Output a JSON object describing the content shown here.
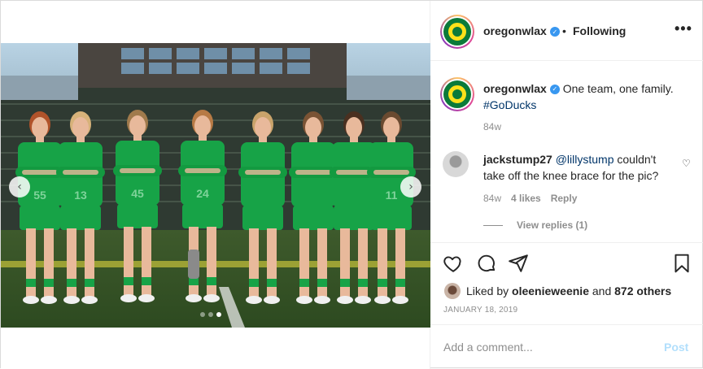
{
  "header": {
    "username": "oregonwlax",
    "separator": "•",
    "follow_status": "Following",
    "more_label": "•••",
    "verified_icon": "✓"
  },
  "caption": {
    "username": "oregonwlax",
    "text": "One team, one family.",
    "hashtag": "#GoDucks",
    "time": "84w"
  },
  "comment": {
    "username": "jackstump27",
    "mention": "@lillystump",
    "text": "couldn't take off the knee brace for the pic?",
    "time": "84w",
    "likes": "4 likes",
    "reply_label": "Reply",
    "view_replies": "View replies (1)",
    "like_icon": "heart-outline"
  },
  "likes": {
    "prefix": "Liked by",
    "user": "oleenieweenie",
    "middle": "and",
    "others": "872 others"
  },
  "date": "JANUARY 18, 2019",
  "add_comment": {
    "placeholder": "Add a comment...",
    "post_label": "Post"
  },
  "carousel": {
    "prev_icon": "‹",
    "next_icon": "›",
    "slide_count": 3,
    "active_index": 2
  },
  "photo": {
    "jersey_numbers": [
      "55",
      "13",
      "45",
      "24",
      "",
      "",
      "",
      "11"
    ]
  },
  "colors": {
    "jersey_green": "#17a347",
    "link_blue": "#003569",
    "verified_blue": "#3897f0",
    "post_disabled": "#b2dffc"
  }
}
